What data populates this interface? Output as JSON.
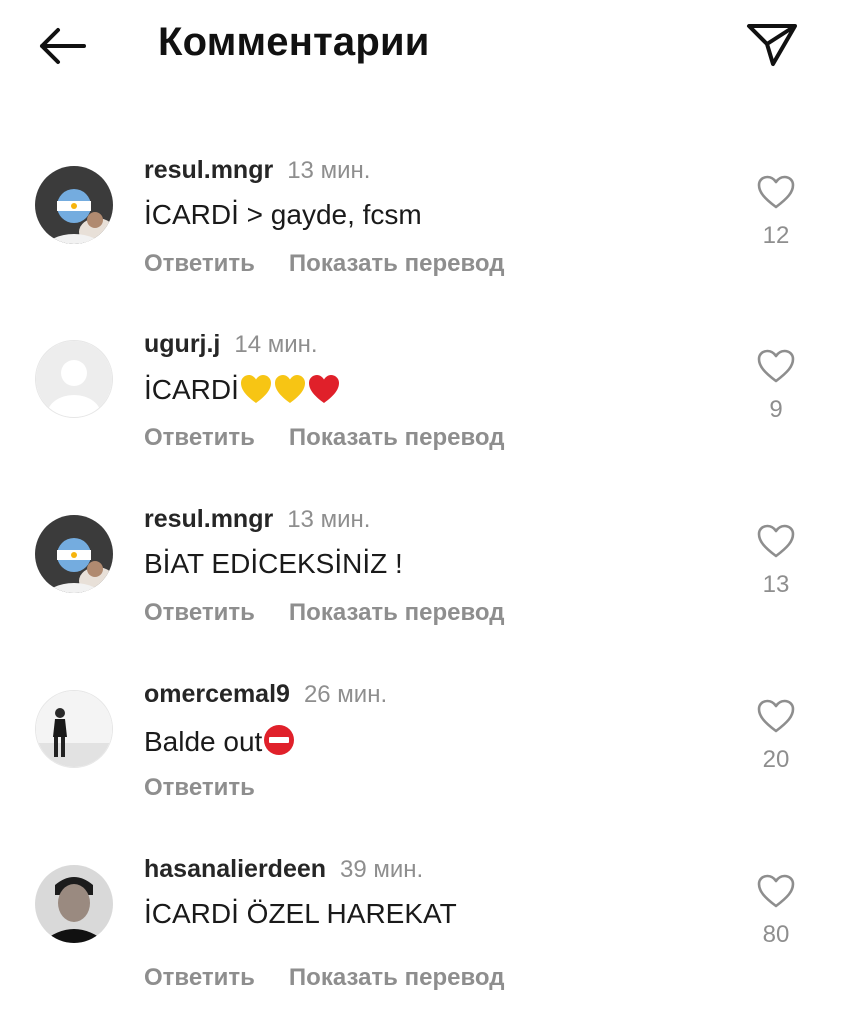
{
  "header": {
    "title": "Комментарии"
  },
  "comments": [
    {
      "username": "resul.mngr",
      "time": "13 мин.",
      "text": "İCARDİ > gayde, fcsm",
      "reply_label": "Ответить",
      "translate_label": "Показать перевод",
      "likes": "12",
      "avatar": "argentina-flag-profile"
    },
    {
      "username": "ugurj.j",
      "time": "14 мин.",
      "text": "İCARDİ",
      "emojis": [
        "yellow-heart",
        "yellow-heart",
        "red-heart"
      ],
      "reply_label": "Ответить",
      "translate_label": "Показать перевод",
      "likes": "9",
      "avatar": "default-profile"
    },
    {
      "username": "resul.mngr",
      "time": "13 мин.",
      "text": "BİAT EDİCEKSİNİZ !",
      "reply_label": "Ответить",
      "translate_label": "Показать перевод",
      "likes": "13",
      "avatar": "argentina-flag-profile"
    },
    {
      "username": "omercemal9",
      "time": "26 мин.",
      "text": "Balde out",
      "emojis": [
        "no-entry"
      ],
      "reply_label": "Ответить",
      "likes": "20",
      "avatar": "person-standing-photo"
    },
    {
      "username": "hasanalierdeen",
      "time": "39 мин.",
      "text": "İCARDİ ÖZEL HAREKAT",
      "reply_label": "Ответить",
      "translate_label": "Показать перевод",
      "likes": "80",
      "avatar": "person-portrait-photo"
    }
  ],
  "colors": {
    "text": "#262626",
    "secondary": "#8e8e8e",
    "background": "#ffffff"
  }
}
